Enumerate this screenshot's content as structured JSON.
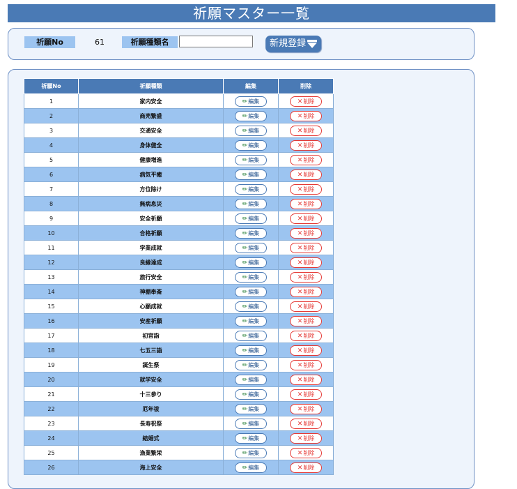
{
  "page": {
    "title": "祈願マスター一覧"
  },
  "search": {
    "no_label": "祈願No",
    "no_value": "61",
    "type_label": "祈願種類名",
    "type_value": "",
    "new_button_label": "新規登録",
    "new_button_icon": "arrow-down-icon"
  },
  "table": {
    "headers": {
      "no": "祈願No",
      "type": "祈願種類",
      "edit": "編集",
      "delete": "削除"
    },
    "edit_label": "編集",
    "delete_label": "削除",
    "rows": [
      {
        "no": "1",
        "type": "家内安全"
      },
      {
        "no": "2",
        "type": "商売繁盛"
      },
      {
        "no": "3",
        "type": "交通安全"
      },
      {
        "no": "4",
        "type": "身体健全"
      },
      {
        "no": "5",
        "type": "健康増進"
      },
      {
        "no": "6",
        "type": "病気平癒"
      },
      {
        "no": "7",
        "type": "方位除け"
      },
      {
        "no": "8",
        "type": "無病息災"
      },
      {
        "no": "9",
        "type": "安全祈願"
      },
      {
        "no": "10",
        "type": "合格祈願"
      },
      {
        "no": "11",
        "type": "学業成就"
      },
      {
        "no": "12",
        "type": "良縁達成"
      },
      {
        "no": "13",
        "type": "旅行安全"
      },
      {
        "no": "14",
        "type": "神棚奉斎"
      },
      {
        "no": "15",
        "type": "心願成就"
      },
      {
        "no": "16",
        "type": "安産祈願"
      },
      {
        "no": "17",
        "type": "初宮詣"
      },
      {
        "no": "18",
        "type": "七五三詣"
      },
      {
        "no": "19",
        "type": "誕生祭"
      },
      {
        "no": "20",
        "type": "就学安全"
      },
      {
        "no": "21",
        "type": "十三参り"
      },
      {
        "no": "22",
        "type": "厄年祓"
      },
      {
        "no": "23",
        "type": "長寿祝祭"
      },
      {
        "no": "24",
        "type": "結婚式"
      },
      {
        "no": "25",
        "type": "漁業繁栄"
      },
      {
        "no": "26",
        "type": "海上安全"
      }
    ]
  },
  "colors": {
    "accent": "#4a7ab5",
    "row_alt": "#9cc4f0",
    "panel_bg": "#eef4fc",
    "edit_icon": "#1d7a2d",
    "delete": "#e53935"
  }
}
